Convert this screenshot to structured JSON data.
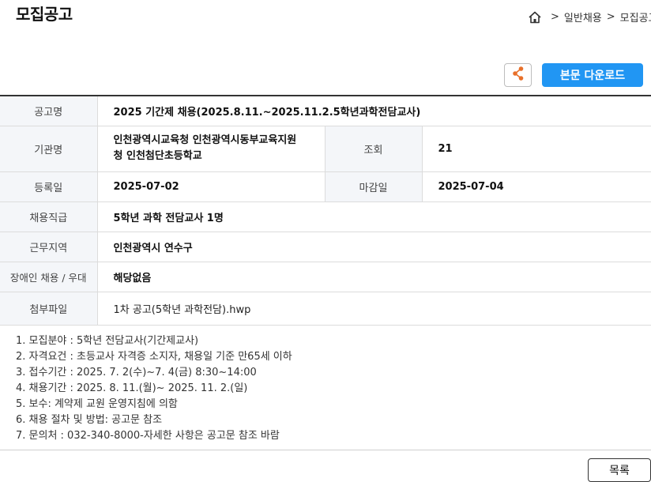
{
  "page_title": "모집공고",
  "breadcrumb": {
    "items": [
      "일반채용",
      "모집공고"
    ],
    "separator": ">"
  },
  "toolbar": {
    "download_label": "본문 다운로드"
  },
  "info": {
    "title_label": "공고명",
    "title_value": "2025 기간제 채용(2025.8.11.~2025.11.2.5학년과학전담교사)",
    "org_label": "기관명",
    "org_value_line1": "인천광역시교육청 인천광역시동부교육지원",
    "org_value_line2": "청 인천첨단초등학교",
    "views_label": "조회",
    "views_value": "21",
    "reg_label": "등록일",
    "reg_value": "2025-07-02",
    "deadline_label": "마감일",
    "deadline_value": "2025-07-04",
    "position_label": "채용직급",
    "position_value": "5학년 과학 전담교사 1명",
    "location_label": "근무지역",
    "location_value": "인천광역시 연수구",
    "disability_label": "장애인 채용 / 우대",
    "disability_value": "해당없음",
    "attach_label": "첨부파일",
    "attach_value": "1차 공고(5학년 과학전담).hwp"
  },
  "details": [
    "1. 모집분야 : 5학년 전담교사(기간제교사)",
    "2. 자격요건 : 초등교사 자격증 소지자, 채용일 기준 만65세 이하",
    "3. 접수기간 : 2025. 7. 2(수)~7. 4(금) 8:30~14:00",
    "4. 채용기간 : 2025. 8. 11.(월)~ 2025. 11. 2.(일)",
    "5. 보수: 계약제 교원 운영지침에 의함",
    "6. 채용 절차 및 방법: 공고문 참조",
    "7. 문의처 : 032-340-8000-자세한 사항은 공고문 참조 바람"
  ],
  "footer": {
    "list_label": "목록"
  },
  "colors": {
    "accent": "#2196f3",
    "share_icon": "#e8702a"
  },
  "icons": {
    "home": "home-icon",
    "share": "share-icon"
  }
}
